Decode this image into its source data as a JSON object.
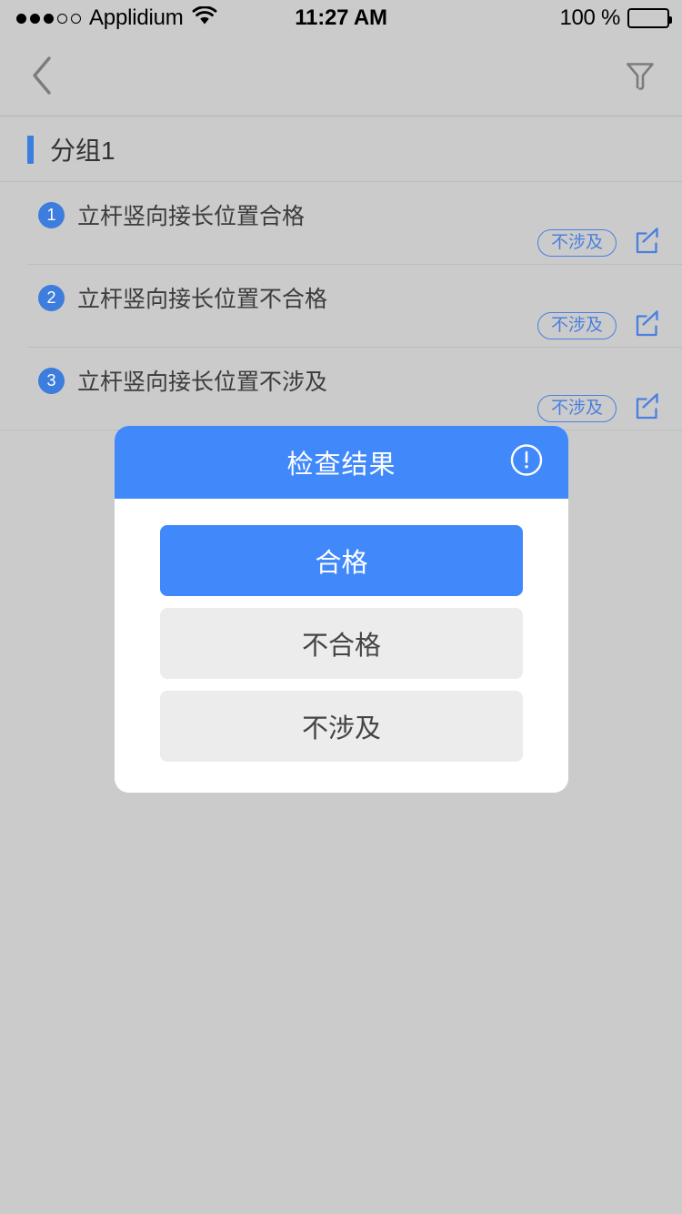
{
  "status_bar": {
    "carrier": "Applidium",
    "signal_dots_total": 5,
    "signal_dots_filled": 3,
    "wifi_icon": "wifi-icon",
    "time": "11:27 AM",
    "battery_percent": "100 %",
    "battery_level": 100
  },
  "nav_bar": {
    "back_icon": "chevron-left-icon",
    "filter_icon": "funnel-filter-icon",
    "title": ""
  },
  "group_header": {
    "title": "分组1",
    "accent_color": "#3c7ddd"
  },
  "checklist": {
    "items": [
      {
        "number": "1",
        "label": "立杆竖向接长位置合格",
        "status": "不涉及",
        "edit_icon": "edit-square-icon"
      },
      {
        "number": "2",
        "label": "立杆竖向接长位置不合格",
        "status": "不涉及",
        "edit_icon": "edit-square-icon"
      },
      {
        "number": "3",
        "label": "立杆竖向接长位置不涉及",
        "status": "不涉及",
        "edit_icon": "edit-square-icon"
      }
    ]
  },
  "dialog": {
    "title": "检查结果",
    "info_icon": "exclamation-circle-icon",
    "header_color": "#4189fb",
    "options": [
      {
        "label": "合格",
        "selected": true
      },
      {
        "label": "不合格",
        "selected": false
      },
      {
        "label": "不涉及",
        "selected": false
      }
    ]
  },
  "colors": {
    "page_background": "#cbcbcb",
    "accent_blue": "#4189fb",
    "badge_blue": "#3c7ddd",
    "pill_blue": "#4a7fe0",
    "option_inactive": "#ececec"
  }
}
